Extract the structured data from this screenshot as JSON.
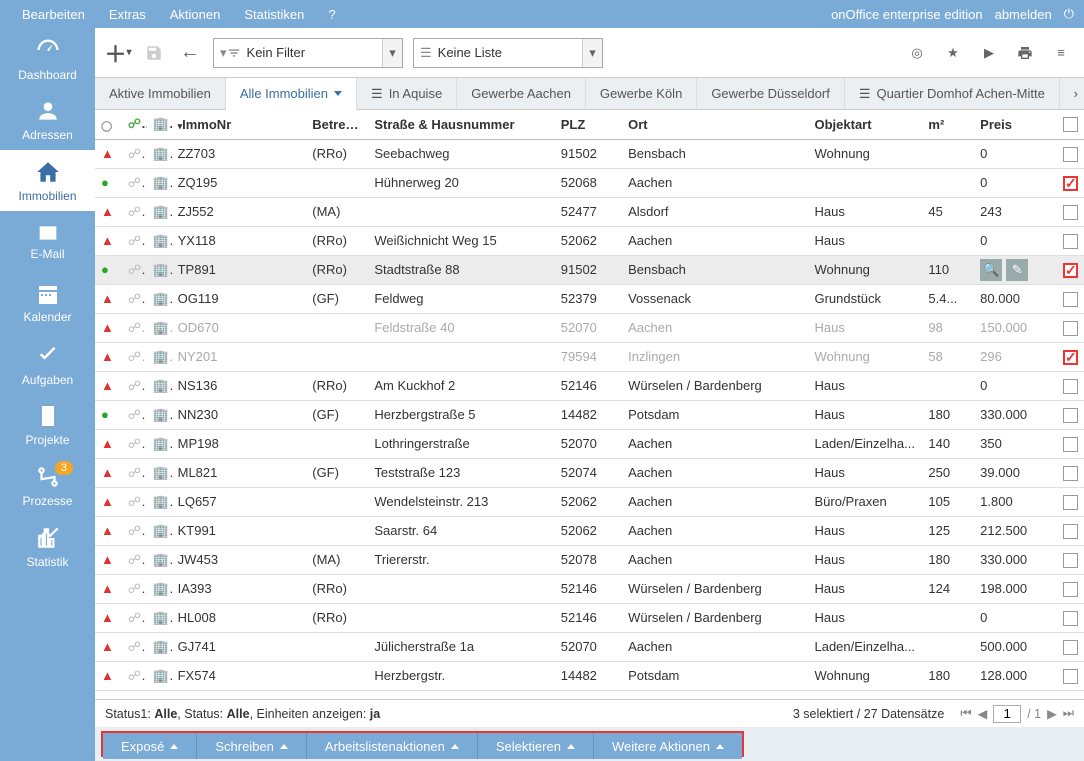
{
  "menubar": {
    "items": [
      "Bearbeiten",
      "Extras",
      "Aktionen",
      "Statistiken",
      "?"
    ],
    "product": "onOffice enterprise edition",
    "logout": "abmelden"
  },
  "sidebar": {
    "items": [
      {
        "key": "dashboard",
        "label": "Dashboard"
      },
      {
        "key": "adressen",
        "label": "Adressen"
      },
      {
        "key": "immobilien",
        "label": "Immobilien",
        "active": true
      },
      {
        "key": "email",
        "label": "E-Mail"
      },
      {
        "key": "kalender",
        "label": "Kalender"
      },
      {
        "key": "aufgaben",
        "label": "Aufgaben"
      },
      {
        "key": "projekte",
        "label": "Projekte"
      },
      {
        "key": "prozesse",
        "label": "Prozesse",
        "badge": "3"
      },
      {
        "key": "statistik",
        "label": "Statistik"
      }
    ]
  },
  "toolbar": {
    "filter_label": "Kein Filter",
    "list_label": "Keine Liste"
  },
  "tabs": {
    "items": [
      {
        "label": "Aktive Immobilien"
      },
      {
        "label": "Alle Immobilien",
        "active": true,
        "dropdown": true
      },
      {
        "label": "In Aquise",
        "icon": "list"
      },
      {
        "label": "Gewerbe Aachen"
      },
      {
        "label": "Gewerbe Köln"
      },
      {
        "label": "Gewerbe Düsseldorf"
      },
      {
        "label": "Quartier Domhof Achen-Mitte",
        "icon": "list"
      }
    ]
  },
  "columns": {
    "immonr": "ImmoNr",
    "betreuer": "Betreuer",
    "strasse": "Straße & Hausnummer",
    "plz": "PLZ",
    "ort": "Ort",
    "art": "Objektart",
    "m2": "m²",
    "preis": "Preis"
  },
  "rows": [
    {
      "st": "red",
      "nr": "ZZ703",
      "bt": "(RRo)",
      "str": "Seebachweg",
      "plz": "91502",
      "ort": "Bensbach",
      "art": "Wohnung",
      "m2": "",
      "pr": "0",
      "chk": "plain"
    },
    {
      "st": "green",
      "nr": "ZQ195",
      "bt": "",
      "str": "Hühnerweg 20",
      "plz": "52068",
      "ort": "Aachen",
      "art": "",
      "m2": "",
      "pr": "0",
      "chk": "red"
    },
    {
      "st": "red",
      "nr": "ZJ552",
      "bt": "(MA)",
      "str": "",
      "plz": "52477",
      "ort": "Alsdorf",
      "art": "Haus",
      "m2": "45",
      "pr": "243",
      "chk": "plain"
    },
    {
      "st": "red",
      "nr": "YX118",
      "bt": "(RRo)",
      "str": "Weißichnicht Weg 15",
      "plz": "52062",
      "ort": "Aachen",
      "art": "Haus",
      "m2": "",
      "pr": "0",
      "chk": "plain"
    },
    {
      "st": "green",
      "nr": "TP891",
      "bt": "(RRo)",
      "str": "Stadtstraße 88",
      "plz": "91502",
      "ort": "Bensbach",
      "art": "Wohnung",
      "m2": "110",
      "pr": "",
      "chk": "red",
      "hover": true,
      "actions": true
    },
    {
      "st": "red",
      "nr": "OG119",
      "bt": "(GF)",
      "str": "Feldweg",
      "plz": "52379",
      "ort": "Vossenack",
      "art": "Grundstück",
      "m2": "5.4...",
      "pr": "80.000",
      "chk": "plain"
    },
    {
      "st": "red",
      "nr": "OD670",
      "bt": "",
      "str": "Feldstraße 40",
      "plz": "52070",
      "ort": "Aachen",
      "art": "Haus",
      "m2": "98",
      "pr": "150.000",
      "chk": "plain",
      "dim": true
    },
    {
      "st": "red",
      "nr": "NY201",
      "bt": "",
      "str": "",
      "plz": "79594",
      "ort": "Inzlingen",
      "art": "Wohnung",
      "m2": "58",
      "pr": "296",
      "chk": "red",
      "dim": true
    },
    {
      "st": "red",
      "nr": "NS136",
      "bt": "(RRo)",
      "str": "Am Kuckhof 2",
      "plz": "52146",
      "ort": "Würselen / Bardenberg",
      "art": "Haus",
      "m2": "",
      "pr": "0",
      "chk": "plain"
    },
    {
      "st": "green",
      "nr": "NN230",
      "bt": "(GF)",
      "str": "Herzbergstraße 5",
      "plz": "14482",
      "ort": "Potsdam",
      "art": "Haus",
      "m2": "180",
      "pr": "330.000",
      "chk": "plain"
    },
    {
      "st": "red",
      "nr": "MP198",
      "bt": "",
      "str": "Lothringerstraße",
      "plz": "52070",
      "ort": "Aachen",
      "art": "Laden/Einzelha...",
      "m2": "140",
      "pr": "350",
      "chk": "plain"
    },
    {
      "st": "red",
      "nr": "ML821",
      "bt": "(GF)",
      "str": "Teststraße 123",
      "plz": "52074",
      "ort": "Aachen",
      "art": "Haus",
      "m2": "250",
      "pr": "39.000",
      "chk": "plain"
    },
    {
      "st": "red",
      "nr": "LQ657",
      "bt": "",
      "str": "Wendelsteinstr. 213",
      "plz": "52062",
      "ort": "Aachen",
      "art": "Büro/Praxen",
      "m2": "105",
      "pr": "1.800",
      "chk": "plain"
    },
    {
      "st": "red",
      "nr": "KT991",
      "bt": "",
      "str": "Saarstr. 64",
      "plz": "52062",
      "ort": "Aachen",
      "art": "Haus",
      "m2": "125",
      "pr": "212.500",
      "chk": "plain"
    },
    {
      "st": "red",
      "nr": "JW453",
      "bt": "(MA)",
      "str": "Triererstr.",
      "plz": "52078",
      "ort": "Aachen",
      "art": "Haus",
      "m2": "180",
      "pr": "330.000",
      "chk": "plain"
    },
    {
      "st": "red",
      "nr": "IA393",
      "bt": "(RRo)",
      "str": "",
      "plz": "52146",
      "ort": "Würselen / Bardenberg",
      "art": "Haus",
      "m2": "124",
      "pr": "198.000",
      "chk": "plain"
    },
    {
      "st": "red",
      "nr": "HL008",
      "bt": "(RRo)",
      "str": "",
      "plz": "52146",
      "ort": "Würselen / Bardenberg",
      "art": "Haus",
      "m2": "",
      "pr": "0",
      "chk": "plain"
    },
    {
      "st": "red",
      "nr": "GJ741",
      "bt": "",
      "str": "Jülicherstraße 1a",
      "plz": "52070",
      "ort": "Aachen",
      "art": "Laden/Einzelha...",
      "m2": "",
      "pr": "500.000",
      "chk": "plain"
    },
    {
      "st": "red",
      "nr": "FX574",
      "bt": "",
      "str": "Herzbergstr.",
      "plz": "14482",
      "ort": "Potsdam",
      "art": "Wohnung",
      "m2": "180",
      "pr": "128.000",
      "chk": "plain"
    }
  ],
  "status": {
    "left_prefix": "Status1: ",
    "left_v1": "Alle",
    "left_mid": ", Status: ",
    "left_v2": "Alle",
    "left_units": ", Einheiten anzeigen: ",
    "left_v3": "ja",
    "right": "3 selektiert / 27 Datensätze",
    "page": "1",
    "total": "/ 1"
  },
  "actions": {
    "items": [
      "Exposé",
      "Schreiben",
      "Arbeitslistenaktionen",
      "Selektieren",
      "Weitere Aktionen"
    ]
  }
}
